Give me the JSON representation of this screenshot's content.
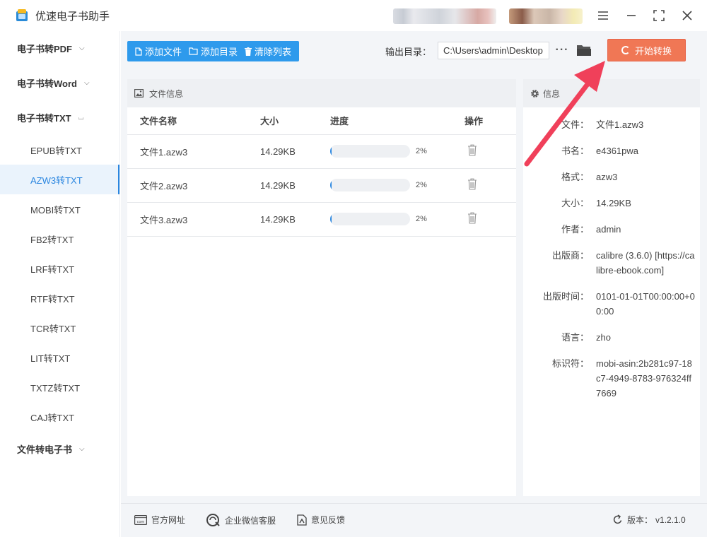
{
  "app": {
    "title": "优速电子书助手"
  },
  "sidebar": {
    "groups": [
      {
        "label": "电子书转PDF",
        "expanded": false
      },
      {
        "label": "电子书转Word",
        "expanded": false
      },
      {
        "label": "电子书转TXT",
        "expanded": true,
        "items": [
          "EPUB转TXT",
          "AZW3转TXT",
          "MOBI转TXT",
          "FB2转TXT",
          "LRF转TXT",
          "RTF转TXT",
          "TCR转TXT",
          "LIT转TXT",
          "TXTZ转TXT",
          "CAJ转TXT"
        ],
        "active_index": 1
      },
      {
        "label": "文件转电子书",
        "expanded": false
      }
    ]
  },
  "toolbar": {
    "add_file": "添加文件",
    "add_dir": "添加目录",
    "clear_list": "清除列表",
    "output_label": "输出目录：",
    "output_path": "C:\\Users\\admin\\Desktop",
    "more": "···",
    "start": "开始转换"
  },
  "files": {
    "panel_title": "文件信息",
    "columns": [
      "文件名称",
      "大小",
      "进度",
      "操作"
    ],
    "rows": [
      {
        "name": "文件1.azw3",
        "size": "14.29KB",
        "progress": 2,
        "progress_text": "2%"
      },
      {
        "name": "文件2.azw3",
        "size": "14.29KB",
        "progress": 2,
        "progress_text": "2%"
      },
      {
        "name": "文件3.azw3",
        "size": "14.29KB",
        "progress": 2,
        "progress_text": "2%"
      }
    ]
  },
  "info": {
    "panel_title": "信息",
    "fields": [
      {
        "key": "文件：",
        "value": "文件1.azw3"
      },
      {
        "key": "书名：",
        "value": "e4361pwa"
      },
      {
        "key": "格式：",
        "value": "azw3"
      },
      {
        "key": "大小：",
        "value": "14.29KB"
      },
      {
        "key": "作者：",
        "value": "admin"
      },
      {
        "key": "出版商：",
        "value": "calibre (3.6.0) [https://calibre-ebook.com]"
      },
      {
        "key": "出版时间：",
        "value": "0101-01-01T00:00:00+00:00"
      },
      {
        "key": "语言：",
        "value": "zho"
      },
      {
        "key": "标识符：",
        "value": "mobi-asin:2b281c97-18c7-4949-8783-976324ff7669"
      }
    ]
  },
  "footer": {
    "website": "官方网址",
    "wechat": "企业微信客服",
    "feedback": "意见反馈",
    "version_label": "版本：",
    "version": "v1.2.1.0"
  },
  "colors": {
    "accent": "#2e9aec",
    "start": "#f07755",
    "arrow": "#f0405a"
  }
}
